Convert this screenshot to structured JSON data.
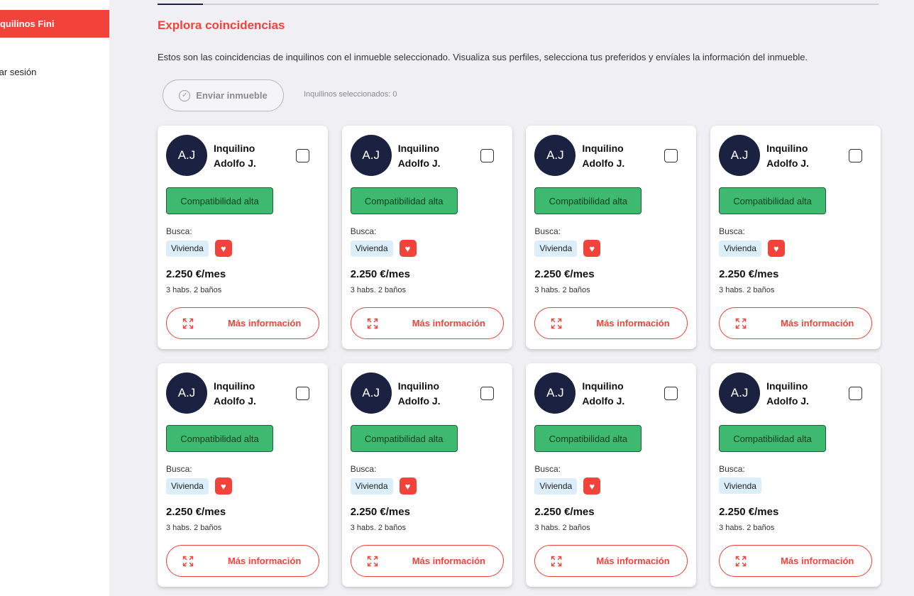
{
  "sidebar": {
    "active_item": "nquilinos Fini",
    "logout_item": "rrar sesión",
    "active_color": "#f2433b"
  },
  "header": {
    "title": "Explora coincidencias",
    "description": "Estos son las coincidencias de inquilinos con el inmueble seleccionado. Visualiza sus perfiles, selecciona tus preferidos y envíales la información del inmueble."
  },
  "actions": {
    "send_label": "Enviar inmueble",
    "selected_label": "Inquilinos seleccionados: 0"
  },
  "cards": [
    {
      "initials": "A.J",
      "line1": "Inquilino",
      "line2": "Adolfo J.",
      "compat": "Compatibilidad alta",
      "busca": "Busca:",
      "tag": "Vivienda",
      "favorite": true,
      "price": "2.250 €/mes",
      "rooms": "3 habs. 2 baños",
      "more": "Más información",
      "checked": false
    },
    {
      "initials": "A.J",
      "line1": "Inquilino",
      "line2": "Adolfo J.",
      "compat": "Compatibilidad alta",
      "busca": "Busca:",
      "tag": "Vivienda",
      "favorite": true,
      "price": "2.250 €/mes",
      "rooms": "3 habs. 2 baños",
      "more": "Más información",
      "checked": false
    },
    {
      "initials": "A.J",
      "line1": "Inquilino",
      "line2": "Adolfo J.",
      "compat": "Compatibilidad alta",
      "busca": "Busca:",
      "tag": "Vivienda",
      "favorite": true,
      "price": "2.250 €/mes",
      "rooms": "3 habs. 2 baños",
      "more": "Más información",
      "checked": false
    },
    {
      "initials": "A.J",
      "line1": "Inquilino",
      "line2": "Adolfo J.",
      "compat": "Compatibilidad alta",
      "busca": "Busca:",
      "tag": "Vivienda",
      "favorite": true,
      "price": "2.250 €/mes",
      "rooms": "3 habs. 2 baños",
      "more": "Más información",
      "checked": false
    },
    {
      "initials": "A.J",
      "line1": "Inquilino",
      "line2": "Adolfo J.",
      "compat": "Compatibilidad alta",
      "busca": "Busca:",
      "tag": "Vivienda",
      "favorite": true,
      "price": "2.250 €/mes",
      "rooms": "3 habs. 2 baños",
      "more": "Más información",
      "checked": false
    },
    {
      "initials": "A.J",
      "line1": "Inquilino",
      "line2": "Adolfo J.",
      "compat": "Compatibilidad alta",
      "busca": "Busca:",
      "tag": "Vivienda",
      "favorite": true,
      "price": "2.250 €/mes",
      "rooms": "3 habs. 2 baños",
      "more": "Más información",
      "checked": false
    },
    {
      "initials": "A.J",
      "line1": "Inquilino",
      "line2": "Adolfo J.",
      "compat": "Compatibilidad alta",
      "busca": "Busca:",
      "tag": "Vivienda",
      "favorite": true,
      "price": "2.250 €/mes",
      "rooms": "3 habs. 2 baños",
      "more": "Más información",
      "checked": false
    },
    {
      "initials": "A.J",
      "line1": "Inquilino",
      "line2": "Adolfo J.",
      "compat": "Compatibilidad alta",
      "busca": "Busca:",
      "tag": "Vivienda",
      "favorite": false,
      "price": "2.250 €/mes",
      "rooms": "3 habs. 2 baños",
      "more": "Más información",
      "checked": false
    }
  ],
  "icons": {
    "send": "check-circle-icon",
    "favorite": "heart-icon",
    "more": "expand-icon"
  },
  "colors": {
    "accent": "#f2433b",
    "avatar": "#1b2140",
    "compat": "#3dba6f",
    "tag": "#dbeefa"
  }
}
